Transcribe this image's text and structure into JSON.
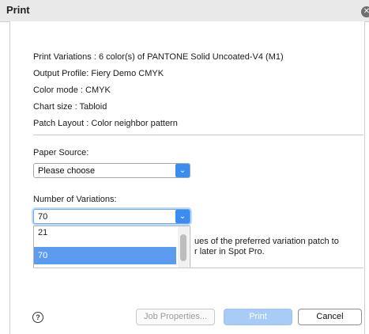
{
  "window": {
    "title": "Print"
  },
  "info": {
    "print_variations": "Print Variations : 6 color(s) of PANTONE Solid Uncoated-V4 (M1)",
    "output_profile": "Output Profile: Fiery Demo CMYK",
    "color_mode": "Color mode : CMYK",
    "chart_size": "Chart size : Tabloid",
    "patch_layout": "Patch Layout : Color neighbor pattern"
  },
  "paper_source": {
    "label": "Paper Source:",
    "value": "Please choose"
  },
  "variations": {
    "label": "Number of Variations:",
    "value": "70",
    "options": [
      "21",
      "70"
    ],
    "selected_option": "70"
  },
  "partial_text": {
    "line1": "ues of the preferred variation patch to",
    "line2": "r later in Spot Pro."
  },
  "buttons": {
    "job_properties": "Job Properties...",
    "print": "Print",
    "cancel": "Cancel"
  },
  "icons": {
    "close": "close-icon",
    "help": "help-icon",
    "dropdown_arrow": "chevron-down-icon"
  },
  "colors": {
    "accent": "#3b8cf0",
    "selection": "#5b9cf0",
    "disabled_primary": "#a9cbf7"
  }
}
